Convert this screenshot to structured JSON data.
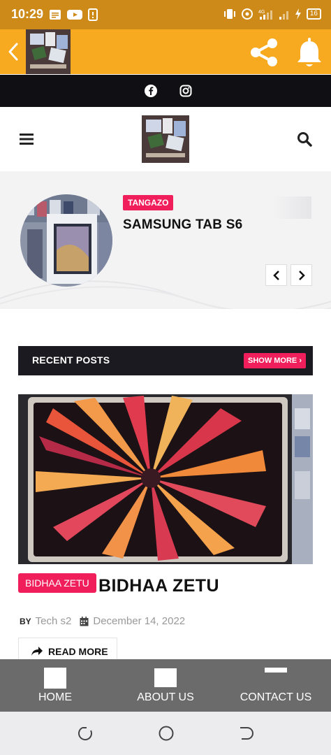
{
  "status_bar": {
    "time": "10:29",
    "battery": "16"
  },
  "app_bar": {
    "logo_caption": ""
  },
  "featured": {
    "tag": "TANGAZO",
    "title": "SAMSUNG TAB S6"
  },
  "recent_posts": {
    "section_title": "RECENT POSTS",
    "show_more_label": "SHOW MORE",
    "post": {
      "tag": "BIDHAA ZETU",
      "title": "BIDHAA ZETU",
      "by_label": "BY",
      "author": "Tech s2",
      "date": "December 14, 2022",
      "read_more_label": "READ MORE"
    }
  },
  "bottom_nav": {
    "items": [
      {
        "label": "HOME"
      },
      {
        "label": "ABOUT US"
      },
      {
        "label": "CONTACT US"
      }
    ]
  },
  "colors": {
    "status_bar": "#cd8a19",
    "app_bar": "#f7a91f",
    "accent": "#f01f5c",
    "dark_bar": "#101014",
    "bottom_nav": "#6b6b6b"
  }
}
